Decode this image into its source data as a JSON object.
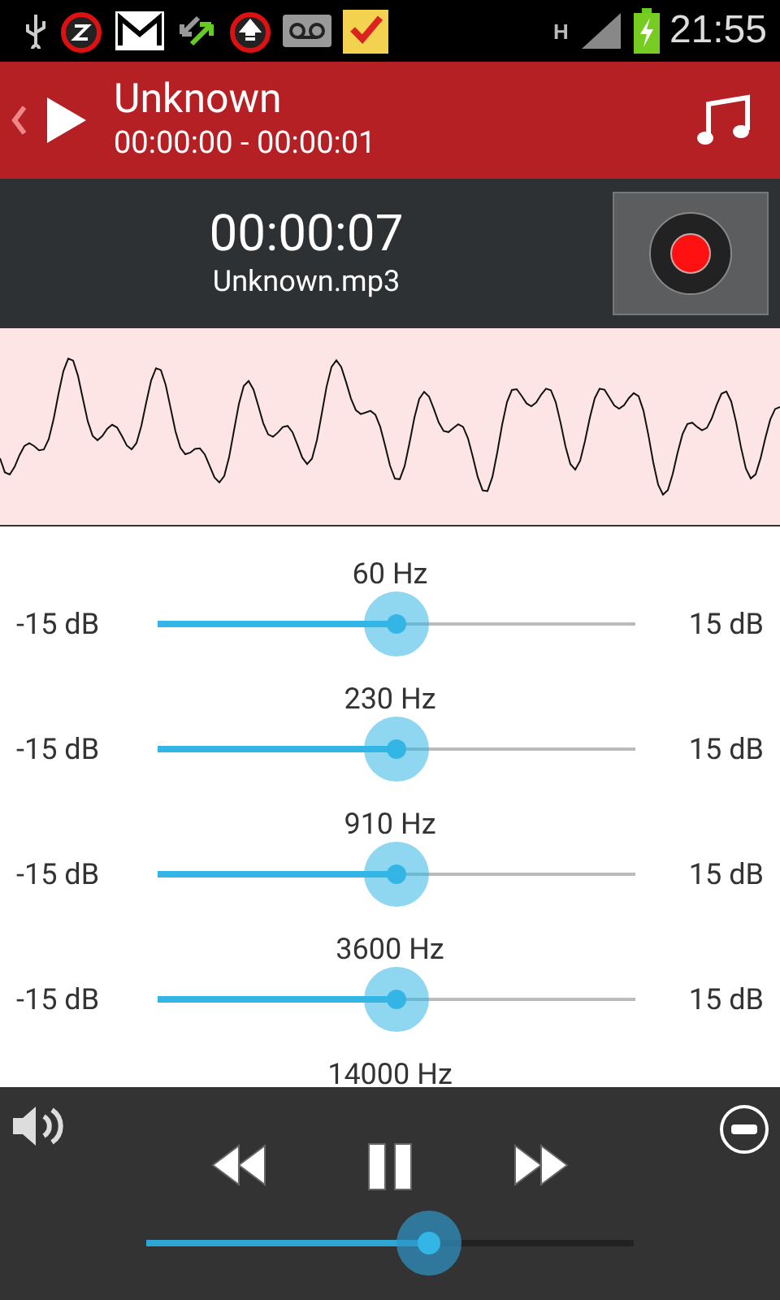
{
  "status_bar": {
    "network_type": "H",
    "time": "21:55"
  },
  "header": {
    "title": "Unknown",
    "subtitle": "00:00:00 - 00:00:01"
  },
  "recorder": {
    "elapsed": "00:00:07",
    "file": "Unknown.mp3"
  },
  "equalizer": {
    "bands": [
      {
        "label": "60 Hz",
        "min": "-15 dB",
        "max": "15 dB",
        "level": 0.5
      },
      {
        "label": "230 Hz",
        "min": "-15 dB",
        "max": "15 dB",
        "level": 0.5
      },
      {
        "label": "910 Hz",
        "min": "-15 dB",
        "max": "15 dB",
        "level": 0.5
      },
      {
        "label": "3600 Hz",
        "min": "-15 dB",
        "max": "15 dB",
        "level": 0.5
      },
      {
        "label": "14000 Hz"
      }
    ]
  },
  "player": {
    "seek": {
      "level": 0.58
    }
  }
}
